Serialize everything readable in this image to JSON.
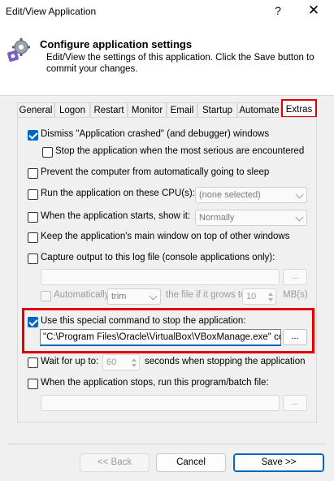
{
  "window": {
    "title": "Edit/View Application",
    "help": "?",
    "close": "✕"
  },
  "header": {
    "title": "Configure application settings",
    "description": "Edit/View the settings of this application. Click the Save button to commit your changes."
  },
  "tabs": [
    "General",
    "Logon",
    "Restart",
    "Monitor",
    "Email",
    "Startup",
    "Automate",
    "Extras"
  ],
  "active_tab": "Extras",
  "options": {
    "dismiss_crash": {
      "label": "Dismiss \"Application crashed\" (and debugger) windows",
      "checked": true
    },
    "stop_on_serious": {
      "label": "Stop the application when the most serious are encountered",
      "checked": false
    },
    "prevent_sleep": {
      "label": "Prevent the computer from automatically going to sleep",
      "checked": false
    },
    "run_on_cpus": {
      "label": "Run the application on these CPU(s):",
      "checked": false,
      "value": "(none selected)"
    },
    "show_it": {
      "label": "When the application starts, show it:",
      "checked": false,
      "value": "Normally"
    },
    "keep_on_top": {
      "label": "Keep the application's main window on top of other windows",
      "checked": false
    },
    "capture_output": {
      "label": "Capture output to this log file (console applications only):",
      "checked": false,
      "browse": "...",
      "auto_label": "Automatically",
      "auto_value": "trim",
      "grows_label": "the file if it grows to",
      "size_value": "10",
      "unit": "MB(s)"
    },
    "stop_command": {
      "label": "Use this special command to stop the application:",
      "checked": true,
      "value": "\"C:\\Program Files\\Oracle\\VirtualBox\\VBoxManage.exe\" controlvm",
      "browse": "..."
    },
    "wait_for": {
      "label": "Wait for up to:",
      "checked": false,
      "value": "60",
      "suffix": "seconds when stopping the application"
    },
    "on_stop_run": {
      "label": "When the application stops, run this program/batch file:",
      "checked": false,
      "browse": "..."
    }
  },
  "buttons": {
    "back": "<< Back",
    "cancel": "Cancel",
    "save": "Save >>"
  },
  "colors": {
    "highlight": "#e00000",
    "accent": "#0067c0"
  }
}
